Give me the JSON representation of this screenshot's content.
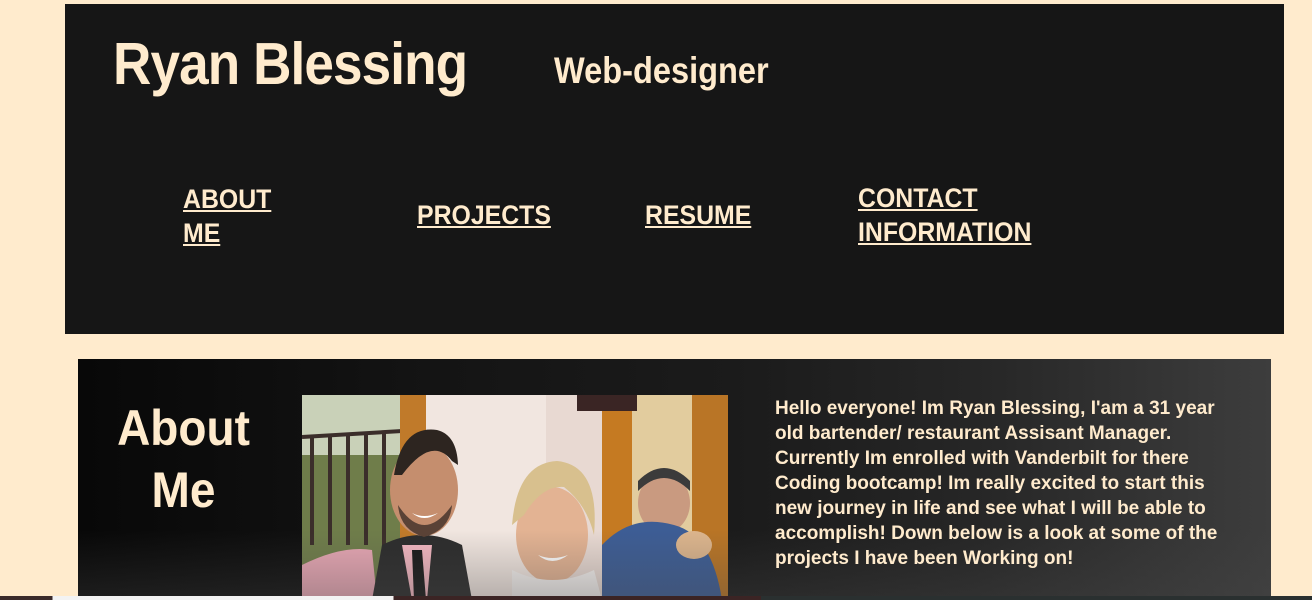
{
  "header": {
    "name": "Ryan Blessing",
    "role": "Web-designer"
  },
  "nav": [
    {
      "label": "ABOUT ME"
    },
    {
      "label": "PROJECTS"
    },
    {
      "label": "RESUME"
    },
    {
      "label": "CONTACT INFORMATION"
    }
  ],
  "about": {
    "title": "About Me",
    "text": "Hello everyone! Im Ryan Blessing, I'am a 31 year old bartender/ restaurant Assisant Manager. Currently Im enrolled with Vanderbilt for there Coding bootcamp! Im really excited to start this new journey in life and see what I will be able to accomplish! Down below is a look at some of the projects I have been Working on!"
  },
  "colors": {
    "page_background": "#ffebcd",
    "header_background": "#161616",
    "text": "#ffebcd"
  }
}
